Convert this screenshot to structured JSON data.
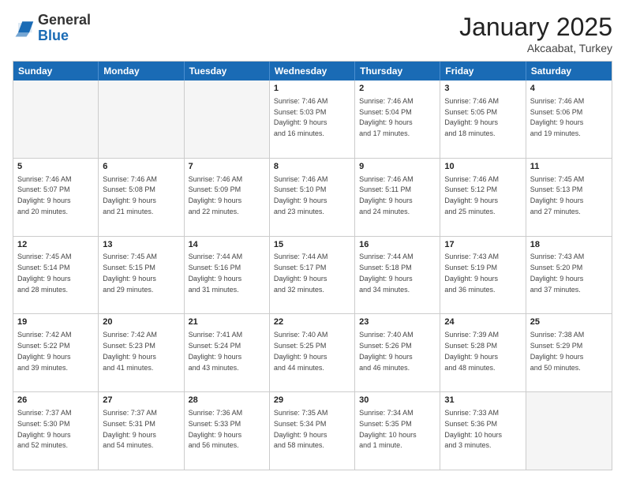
{
  "logo": {
    "general": "General",
    "blue": "Blue"
  },
  "header": {
    "month": "January 2025",
    "location": "Akcaabat, Turkey"
  },
  "days": [
    "Sunday",
    "Monday",
    "Tuesday",
    "Wednesday",
    "Thursday",
    "Friday",
    "Saturday"
  ],
  "rows": [
    [
      {
        "day": "",
        "info": ""
      },
      {
        "day": "",
        "info": ""
      },
      {
        "day": "",
        "info": ""
      },
      {
        "day": "1",
        "info": "Sunrise: 7:46 AM\nSunset: 5:03 PM\nDaylight: 9 hours\nand 16 minutes."
      },
      {
        "day": "2",
        "info": "Sunrise: 7:46 AM\nSunset: 5:04 PM\nDaylight: 9 hours\nand 17 minutes."
      },
      {
        "day": "3",
        "info": "Sunrise: 7:46 AM\nSunset: 5:05 PM\nDaylight: 9 hours\nand 18 minutes."
      },
      {
        "day": "4",
        "info": "Sunrise: 7:46 AM\nSunset: 5:06 PM\nDaylight: 9 hours\nand 19 minutes."
      }
    ],
    [
      {
        "day": "5",
        "info": "Sunrise: 7:46 AM\nSunset: 5:07 PM\nDaylight: 9 hours\nand 20 minutes."
      },
      {
        "day": "6",
        "info": "Sunrise: 7:46 AM\nSunset: 5:08 PM\nDaylight: 9 hours\nand 21 minutes."
      },
      {
        "day": "7",
        "info": "Sunrise: 7:46 AM\nSunset: 5:09 PM\nDaylight: 9 hours\nand 22 minutes."
      },
      {
        "day": "8",
        "info": "Sunrise: 7:46 AM\nSunset: 5:10 PM\nDaylight: 9 hours\nand 23 minutes."
      },
      {
        "day": "9",
        "info": "Sunrise: 7:46 AM\nSunset: 5:11 PM\nDaylight: 9 hours\nand 24 minutes."
      },
      {
        "day": "10",
        "info": "Sunrise: 7:46 AM\nSunset: 5:12 PM\nDaylight: 9 hours\nand 25 minutes."
      },
      {
        "day": "11",
        "info": "Sunrise: 7:45 AM\nSunset: 5:13 PM\nDaylight: 9 hours\nand 27 minutes."
      }
    ],
    [
      {
        "day": "12",
        "info": "Sunrise: 7:45 AM\nSunset: 5:14 PM\nDaylight: 9 hours\nand 28 minutes."
      },
      {
        "day": "13",
        "info": "Sunrise: 7:45 AM\nSunset: 5:15 PM\nDaylight: 9 hours\nand 29 minutes."
      },
      {
        "day": "14",
        "info": "Sunrise: 7:44 AM\nSunset: 5:16 PM\nDaylight: 9 hours\nand 31 minutes."
      },
      {
        "day": "15",
        "info": "Sunrise: 7:44 AM\nSunset: 5:17 PM\nDaylight: 9 hours\nand 32 minutes."
      },
      {
        "day": "16",
        "info": "Sunrise: 7:44 AM\nSunset: 5:18 PM\nDaylight: 9 hours\nand 34 minutes."
      },
      {
        "day": "17",
        "info": "Sunrise: 7:43 AM\nSunset: 5:19 PM\nDaylight: 9 hours\nand 36 minutes."
      },
      {
        "day": "18",
        "info": "Sunrise: 7:43 AM\nSunset: 5:20 PM\nDaylight: 9 hours\nand 37 minutes."
      }
    ],
    [
      {
        "day": "19",
        "info": "Sunrise: 7:42 AM\nSunset: 5:22 PM\nDaylight: 9 hours\nand 39 minutes."
      },
      {
        "day": "20",
        "info": "Sunrise: 7:42 AM\nSunset: 5:23 PM\nDaylight: 9 hours\nand 41 minutes."
      },
      {
        "day": "21",
        "info": "Sunrise: 7:41 AM\nSunset: 5:24 PM\nDaylight: 9 hours\nand 43 minutes."
      },
      {
        "day": "22",
        "info": "Sunrise: 7:40 AM\nSunset: 5:25 PM\nDaylight: 9 hours\nand 44 minutes."
      },
      {
        "day": "23",
        "info": "Sunrise: 7:40 AM\nSunset: 5:26 PM\nDaylight: 9 hours\nand 46 minutes."
      },
      {
        "day": "24",
        "info": "Sunrise: 7:39 AM\nSunset: 5:28 PM\nDaylight: 9 hours\nand 48 minutes."
      },
      {
        "day": "25",
        "info": "Sunrise: 7:38 AM\nSunset: 5:29 PM\nDaylight: 9 hours\nand 50 minutes."
      }
    ],
    [
      {
        "day": "26",
        "info": "Sunrise: 7:37 AM\nSunset: 5:30 PM\nDaylight: 9 hours\nand 52 minutes."
      },
      {
        "day": "27",
        "info": "Sunrise: 7:37 AM\nSunset: 5:31 PM\nDaylight: 9 hours\nand 54 minutes."
      },
      {
        "day": "28",
        "info": "Sunrise: 7:36 AM\nSunset: 5:33 PM\nDaylight: 9 hours\nand 56 minutes."
      },
      {
        "day": "29",
        "info": "Sunrise: 7:35 AM\nSunset: 5:34 PM\nDaylight: 9 hours\nand 58 minutes."
      },
      {
        "day": "30",
        "info": "Sunrise: 7:34 AM\nSunset: 5:35 PM\nDaylight: 10 hours\nand 1 minute."
      },
      {
        "day": "31",
        "info": "Sunrise: 7:33 AM\nSunset: 5:36 PM\nDaylight: 10 hours\nand 3 minutes."
      },
      {
        "day": "",
        "info": ""
      }
    ]
  ]
}
